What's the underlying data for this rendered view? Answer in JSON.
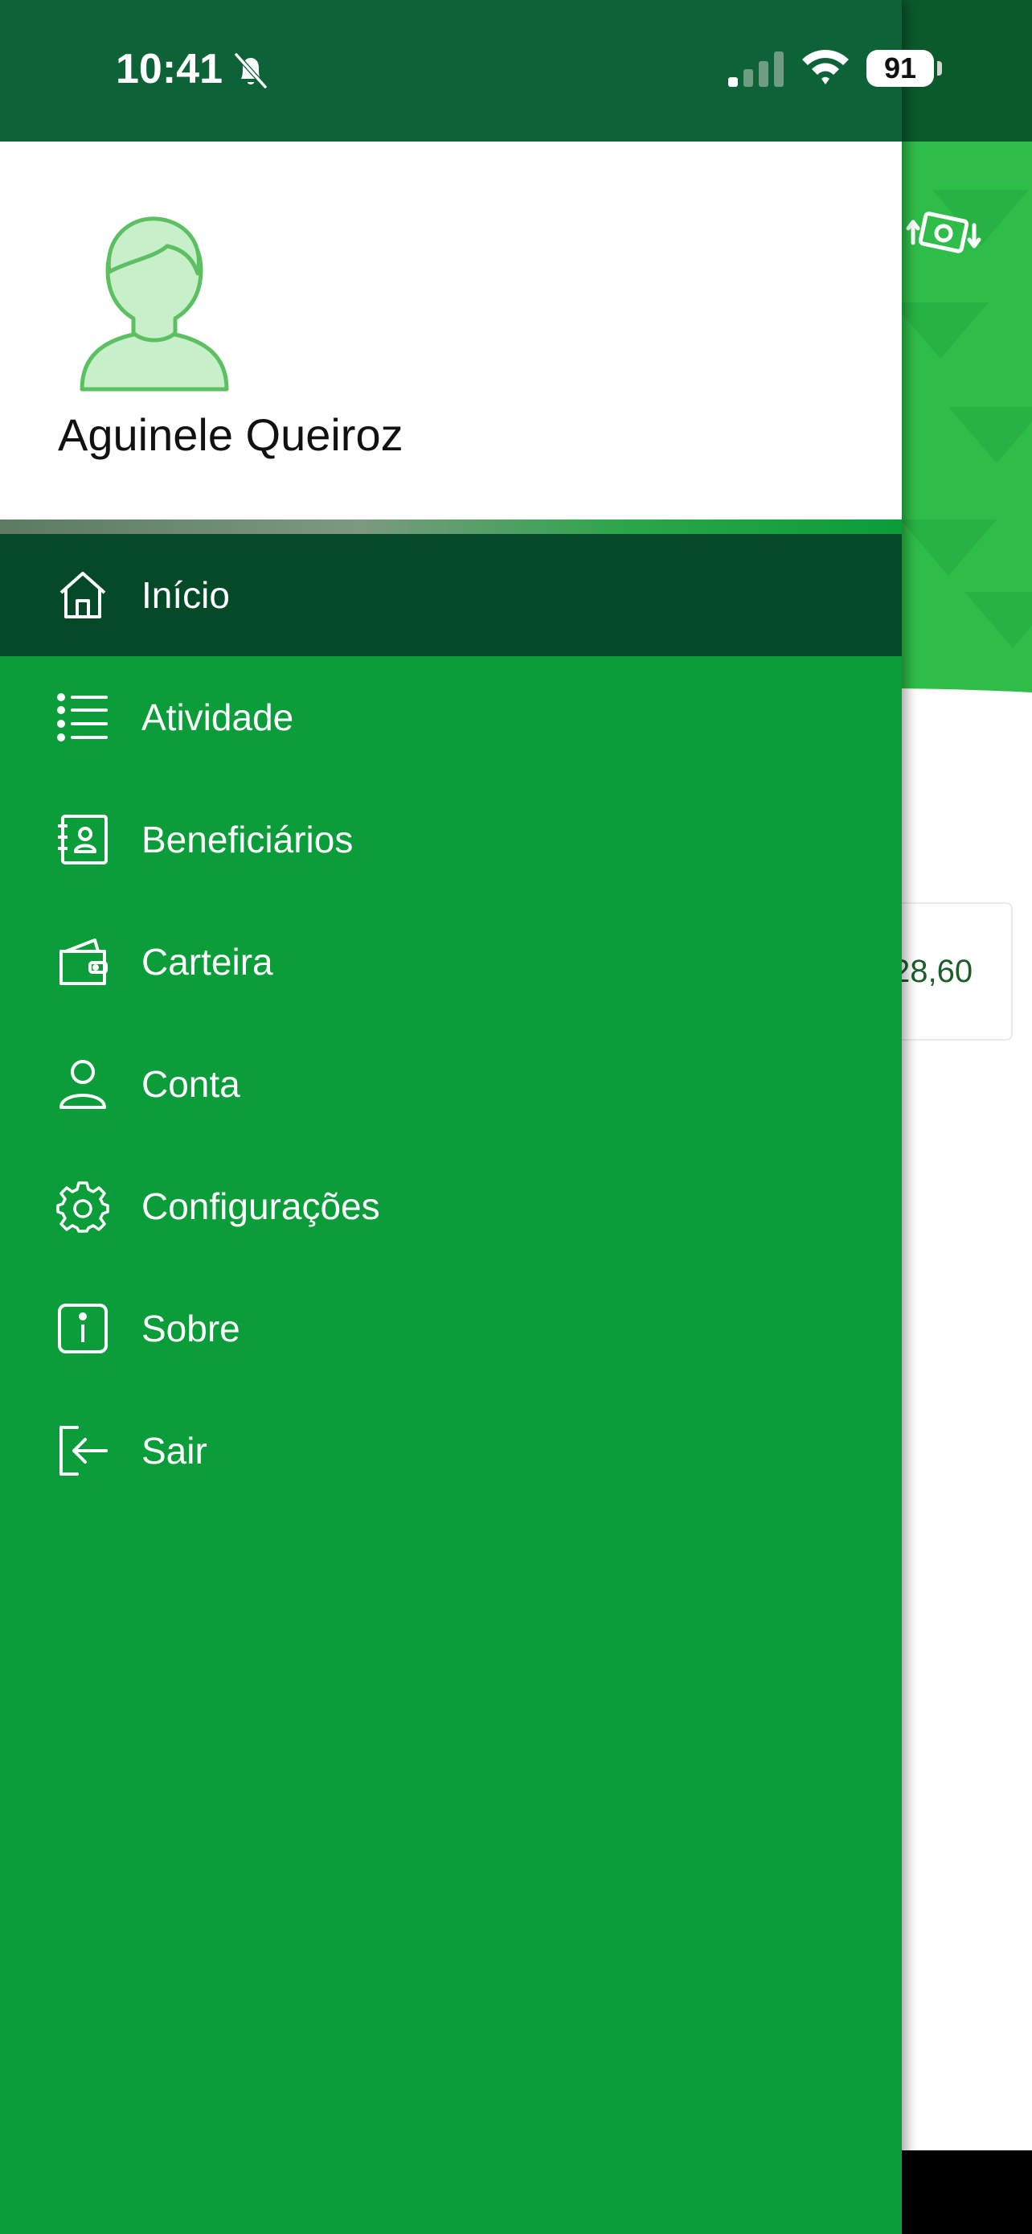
{
  "status_bar": {
    "time": "10:41",
    "battery": "91"
  },
  "user": {
    "name": "Aguinele Queiroz"
  },
  "menu": {
    "items": [
      {
        "label": "Início",
        "icon": "home-icon",
        "active": true
      },
      {
        "label": "Atividade",
        "icon": "list-icon",
        "active": false
      },
      {
        "label": "Beneficiários",
        "icon": "contacts-book-icon",
        "active": false
      },
      {
        "label": "Carteira",
        "icon": "wallet-icon",
        "active": false
      },
      {
        "label": "Conta",
        "icon": "user-icon",
        "active": false
      },
      {
        "label": "Configurações",
        "icon": "gear-icon",
        "active": false
      },
      {
        "label": "Sobre",
        "icon": "info-icon",
        "active": false
      },
      {
        "label": "Sair",
        "icon": "logout-icon",
        "active": false
      }
    ]
  },
  "background": {
    "balance_fragment": "28,60"
  },
  "colors": {
    "drawer_green": "#0a9d3a",
    "active_item": "#054a28",
    "status_bar": "#0e6238",
    "hero_green": "#2fbd49"
  }
}
